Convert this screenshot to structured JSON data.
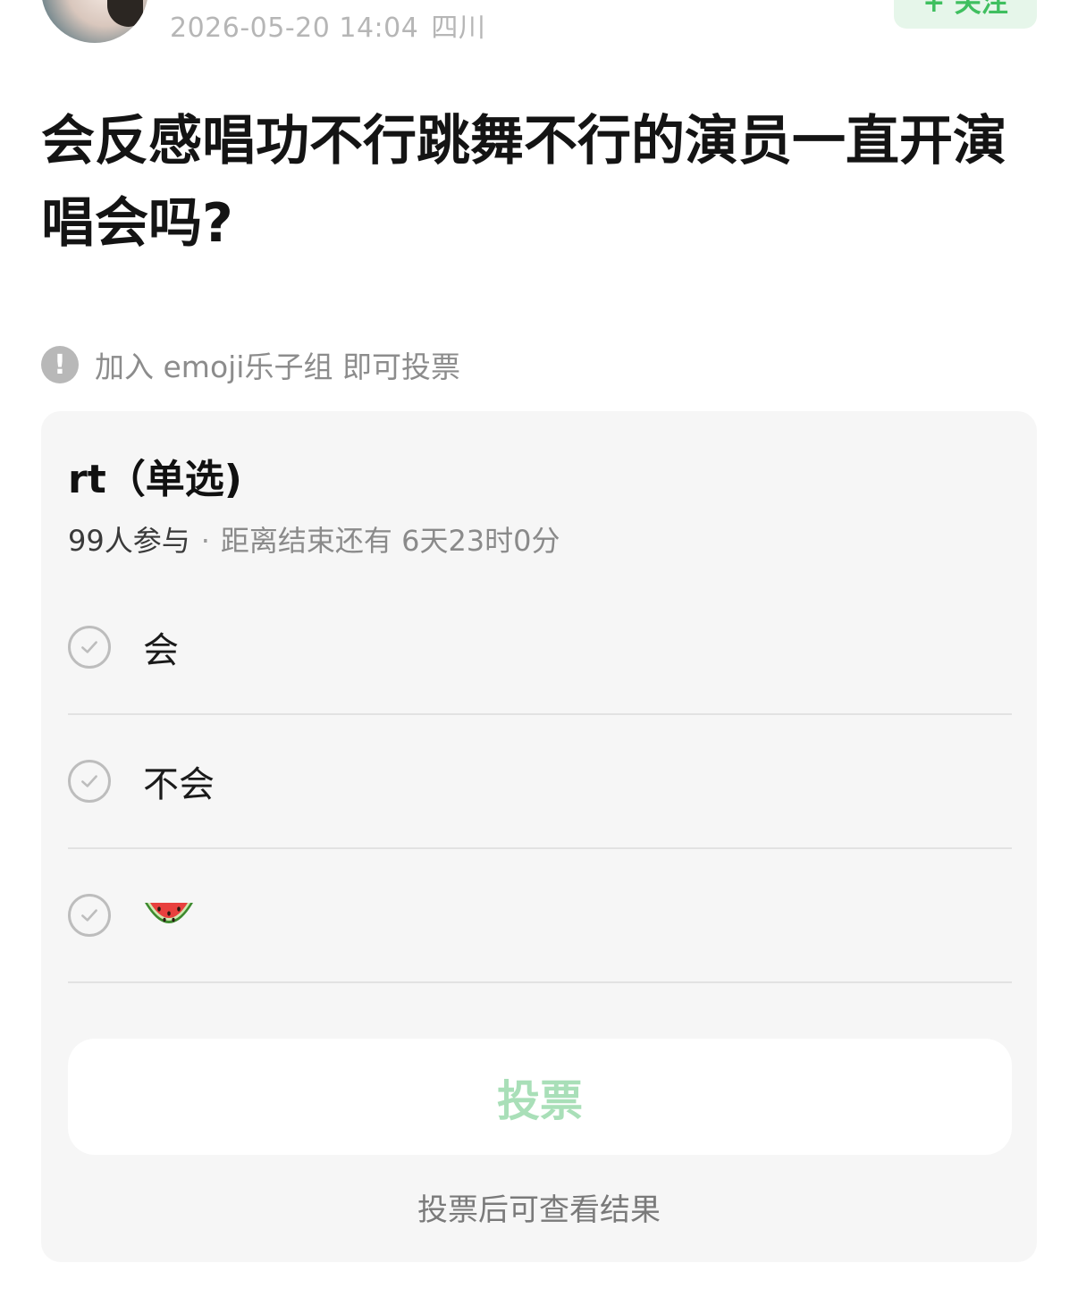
{
  "header": {
    "datetime": "2026-05-20 14:04",
    "location": "四川",
    "follow_label": "+ 关注"
  },
  "post": {
    "title": "会反感唱功不行跳舞不行的演员一直开演唱会吗?"
  },
  "notice": {
    "icon": "exclamation-icon",
    "text": "加入 emoji乐子组 即可投票"
  },
  "poll": {
    "title": "rt（单选)",
    "participants": "99人参与",
    "separator": "·",
    "time_remaining": "距离结束还有 6天23时0分",
    "options": [
      {
        "label": "会",
        "icon": "check-circle-icon"
      },
      {
        "label": "不会",
        "icon": "check-circle-icon"
      },
      {
        "label": "",
        "emoji": "watermelon-icon",
        "icon": "check-circle-icon"
      }
    ],
    "vote_button": "投票",
    "hint": "投票后可查看结果"
  },
  "colors": {
    "accent_green": "#3fbf5f",
    "vote_button_text": "#a9dfb8",
    "card_bg": "#f6f6f6"
  }
}
